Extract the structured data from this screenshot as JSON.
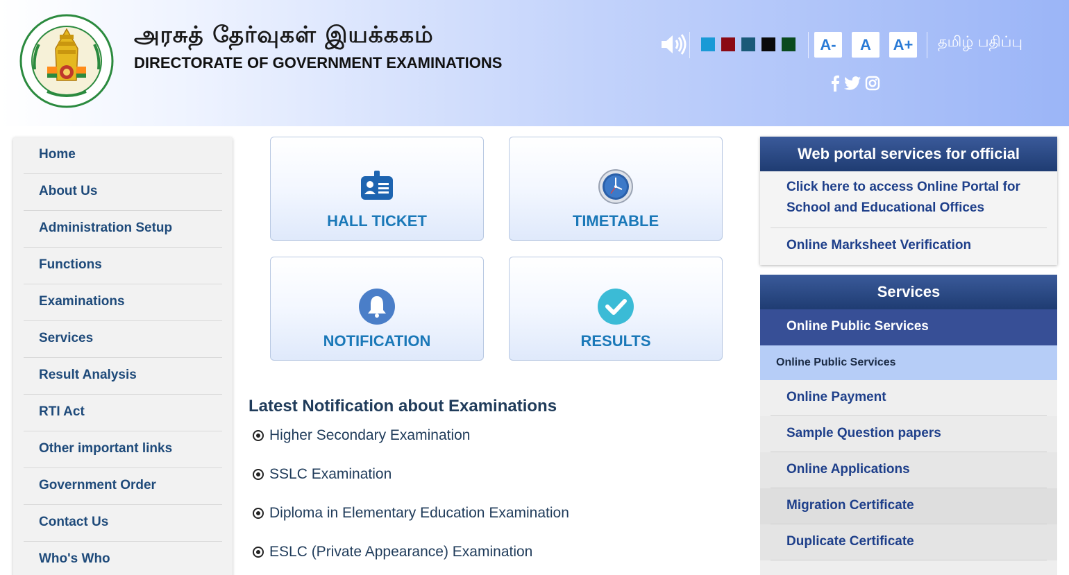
{
  "header": {
    "title_tamil": "அரசுத் தேர்வுகள் இயக்ககம்",
    "title_english": "DIRECTORATE OF GOVERNMENT EXAMINATIONS",
    "logo_icon": "tamil-nadu-emblem-icon",
    "speaker_icon": "speaker-icon",
    "theme_colors": [
      "#1a9ad6",
      "#8b0a14",
      "#1a5a78",
      "#0a0a0a",
      "#0a4a1e"
    ],
    "font_controls": [
      "A-",
      "A",
      "A+"
    ],
    "language_link": "தமிழ் பதிப்பு",
    "social_icons": [
      "facebook-icon",
      "twitter-icon",
      "instagram-icon"
    ]
  },
  "left_nav": {
    "items": [
      {
        "label": "Home"
      },
      {
        "label": "About Us"
      },
      {
        "label": "Administration Setup"
      },
      {
        "label": "Functions"
      },
      {
        "label": "Examinations"
      },
      {
        "label": "Services"
      },
      {
        "label": "Result Analysis"
      },
      {
        "label": "RTI Act"
      },
      {
        "label": "Other important links"
      },
      {
        "label": "Government Order"
      },
      {
        "label": "Contact Us"
      },
      {
        "label": "Who's Who"
      }
    ]
  },
  "tiles": [
    {
      "label": "HALL TICKET",
      "icon": "id-card-icon"
    },
    {
      "label": "TIMETABLE",
      "icon": "clock-icon"
    },
    {
      "label": "NOTIFICATION",
      "icon": "bell-icon"
    },
    {
      "label": "RESULTS",
      "icon": "checkmark-icon"
    }
  ],
  "notifications": {
    "title": "Latest Notification about Examinations",
    "items": [
      {
        "text": "Higher Secondary Examination"
      },
      {
        "text": "SSLC Examination"
      },
      {
        "text": "Diploma in Elementary Education Examination"
      },
      {
        "text": "ESLC (Private Appearance) Examination"
      }
    ]
  },
  "official_panel": {
    "title": "Web portal services for official",
    "links": [
      {
        "line1": "Click here to access Online Portal for",
        "line2": "School and Educational Offices"
      },
      {
        "line1": "Online Marksheet Verification"
      }
    ]
  },
  "services_panel": {
    "title": "Services",
    "active": "Online Public Services",
    "sub": "Online Public Services",
    "items": [
      {
        "label": "Online Payment"
      },
      {
        "label": "Sample Question papers"
      },
      {
        "label": "Online Applications"
      },
      {
        "label": "Migration Certificate"
      },
      {
        "label": "Duplicate Certificate"
      }
    ]
  }
}
